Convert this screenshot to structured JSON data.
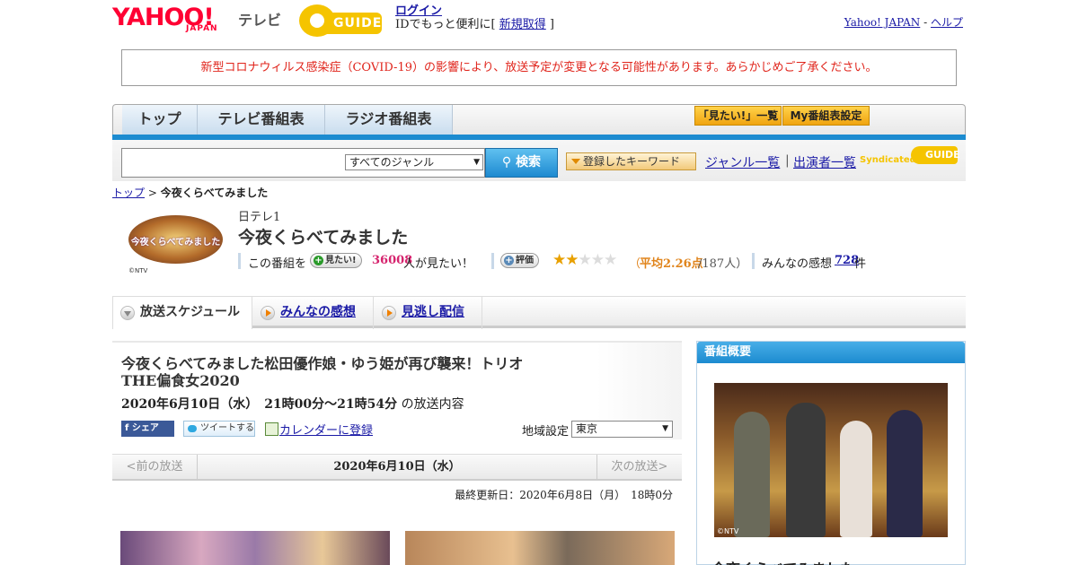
{
  "header": {
    "logo": "YAHOO!",
    "logo_sub": "JAPAN",
    "logo_tv": "テレビ",
    "gguide": "GUIDE",
    "login_link": "ログイン",
    "login_text_pre": "IDでもっと便利に[ ",
    "signup_link": "新規取得",
    "login_text_post": " ]",
    "yahoo_japan_link": "Yahoo! JAPAN",
    "separator": " - ",
    "help_link": "ヘルプ"
  },
  "notice": "新型コロナウィルス感染症（COVID-19）の影響により、放送予定が変更となる可能性があります。あらかじめご了承ください。",
  "nav": {
    "tabs": [
      "トップ",
      "テレビ番組表",
      "ラジオ番組表"
    ],
    "want_list": "「見たい!」一覧",
    "my_settings": "My番組表設定"
  },
  "search": {
    "input_value": "",
    "genre_selected": "すべてのジャンル",
    "button": "検索",
    "keyword_button": "登録したキーワード",
    "genre_list": "ジャンル一覧",
    "sep": "|",
    "cast_list": "出演者一覧",
    "syndicated": "Syndicated",
    "syndicated_guide": "GUIDE"
  },
  "breadcrumb": {
    "top": "トップ",
    "sep": " > ",
    "current": "今夜くらべてみました"
  },
  "program": {
    "logo_text": "今夜くらべてみました",
    "copyright": "©NTV",
    "channel": "日テレ1",
    "title": "今夜くらべてみました",
    "want_pre": "この番組を",
    "want_button": "見たい!",
    "want_count": "36008",
    "want_post": "人が見たい！",
    "rating_button": "評価",
    "rating_value": 2.26,
    "stars_filled": 2,
    "stars_total": 5,
    "avg_pre": "（",
    "avg_text": "平均2.26点",
    "avg_count": "/187人）",
    "comments_pre": "みんなの感想",
    "comments_count": "728",
    "comments_post": "件"
  },
  "tabs": [
    "放送スケジュール",
    "みんなの感想",
    "見逃し配信"
  ],
  "episode": {
    "title": "今夜くらべてみました松田優作娘・ゆう姫が再び襲来！トリオTHE偏食女2020",
    "date": "2020年6月10日（水）　21時00分～21時54分",
    "date_suffix": "の放送内容",
    "share": "シェア",
    "tweet": "ツイートする",
    "calendar": "カレンダーに登録",
    "region_label": "地域設定",
    "region_value": "東京"
  },
  "date_nav": {
    "prev": "<前の放送",
    "current": "2020年6月10日（水）",
    "next": "次の放送>"
  },
  "updated": "最終更新日：2020年6月8日（月）　18時0分",
  "overview": {
    "heading": "番組概要",
    "photo_credit": "©NTV",
    "title": "今夜くらべてみました"
  },
  "colors": {
    "accent_blue": "#1c8bd0",
    "yahoo_red": "#ff0033",
    "gguide_yellow": "#f5c400",
    "notice_red": "#e0241b",
    "want_pink": "#d6246e",
    "star_orange": "#e8a000"
  }
}
